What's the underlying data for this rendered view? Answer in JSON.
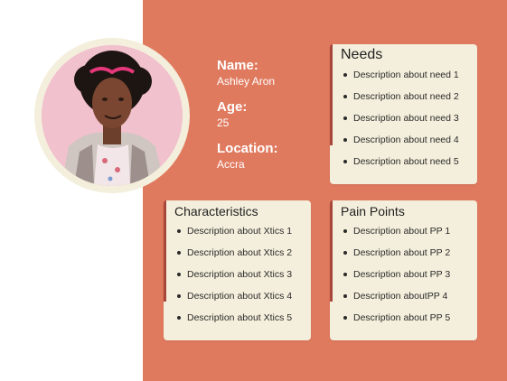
{
  "profile": {
    "name_label": "Name:",
    "name": "Ashley Aron",
    "age_label": "Age:",
    "age": "25",
    "location_label": "Location:",
    "location": "Accra"
  },
  "needs": {
    "title": "Needs",
    "items": [
      "Description about need 1",
      "Description about need 2",
      "Description about need 3",
      "Description about need 4",
      "Description about need 5"
    ]
  },
  "characteristics": {
    "title": "Characteristics",
    "items": [
      "Description about Xtics 1",
      "Description about Xtics 2",
      "Description about Xtics 3",
      "Description about Xtics 4",
      "Description about Xtics 5"
    ]
  },
  "pain_points": {
    "title": "Pain Points",
    "items": [
      "Description about PP 1",
      "Description about PP 2",
      "Description about PP 3",
      "Description aboutPP 4",
      "Description about PP 5"
    ]
  },
  "colors": {
    "background_panel": "#e07a5f",
    "card": "#f4efdc",
    "accent_bar": "#a8463a",
    "text_light": "#ffffff"
  }
}
